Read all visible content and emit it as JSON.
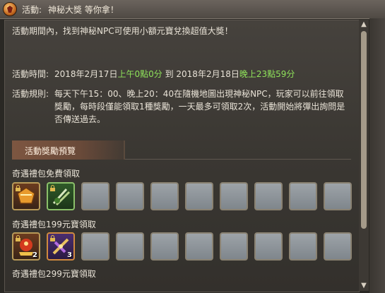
{
  "header": {
    "label": "活動:",
    "title": "神秘大獎 等你拿！"
  },
  "intro": "活動期間內，找到神秘NPC可使用小額元寶兌換超值大獎！",
  "time": {
    "label": "活動時間:",
    "start_date": "2018年2月17日",
    "start_time": "上午0點0分",
    "to": "到",
    "end_date": "2018年2月18日",
    "end_time": "晚上23點59分"
  },
  "rules": {
    "label": "活動規則:",
    "body": "每天下午15：00、晚上20：40在隨機地圖出現神秘NPC，玩家可以前往領取獎勵，每時段僅能領取1種獎勵，一天最多可領取2次，活動開始將彈出詢問是否傳送過去。"
  },
  "section": {
    "tab": "活動獎勵預覽"
  },
  "rewards": [
    {
      "label": "奇遇禮包免費領取",
      "slots": [
        {
          "icon": "gift-box-icon",
          "count": ""
        },
        {
          "icon": "sword-bundle-icon",
          "count": ""
        }
      ]
    },
    {
      "label": "奇遇禮包199元寶領取",
      "slots": [
        {
          "icon": "gift-box-icon",
          "count": "2"
        },
        {
          "icon": "purple-weapon-icon",
          "count": "3"
        }
      ]
    },
    {
      "label": "奇遇禮包299元寶領取",
      "slots": []
    }
  ],
  "scrollbar": {
    "up": "▲",
    "down": "▼"
  },
  "colors": {
    "highlight": "#8fe25a"
  }
}
